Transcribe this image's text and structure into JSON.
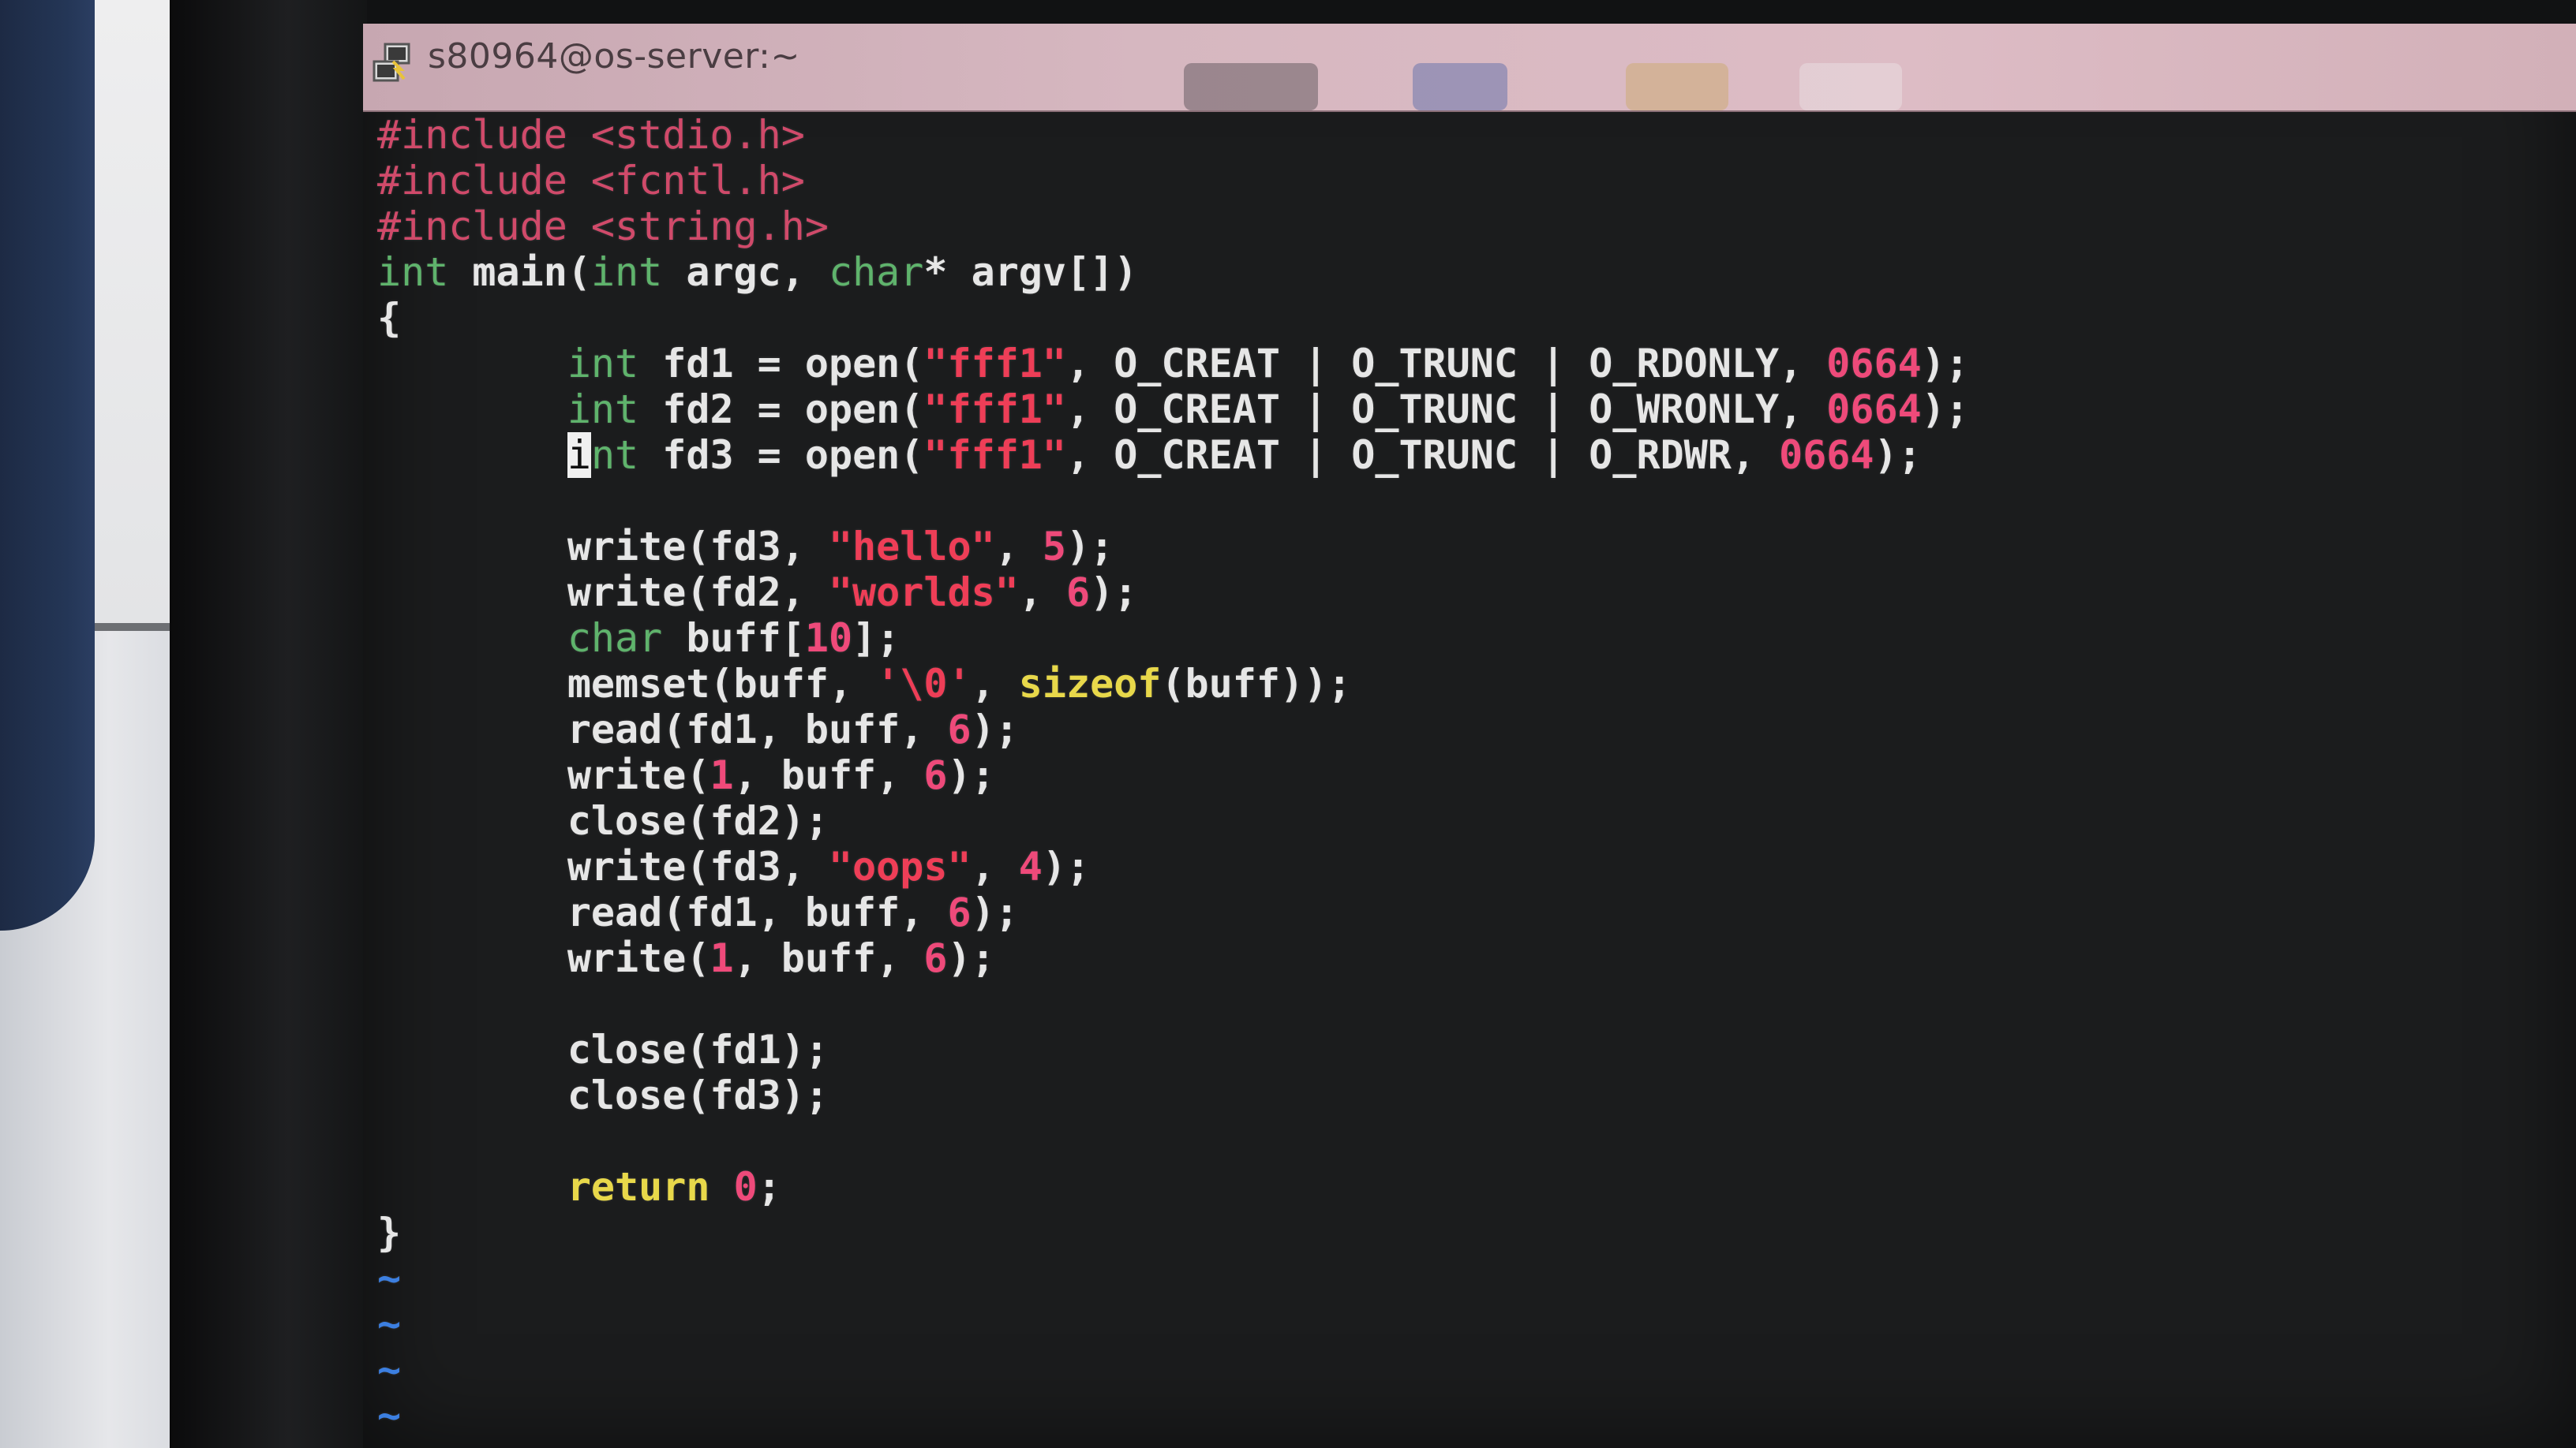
{
  "window": {
    "title": "s80964@os-server:~",
    "icon": "putty-terminal-icon"
  },
  "colors": {
    "preprocessor": "#d04a6a",
    "type_keyword": "#5fb36c",
    "string": "#ee3e57",
    "number": "#ee4a7a",
    "statement": "#e8d84a",
    "text": "#e6e6e6",
    "tilde": "#3c7fe0",
    "titlebar": "#d6b7c0"
  },
  "editor": {
    "cursor_line": 7,
    "lines": [
      [
        [
          "pp",
          "#include <stdio.h>"
        ]
      ],
      [
        [
          "pp",
          "#include <fcntl.h>"
        ]
      ],
      [
        [
          "pp",
          "#include <string.h>"
        ]
      ],
      [
        [
          "kw",
          "int"
        ],
        [
          "id",
          " main("
        ],
        [
          "kw",
          "int"
        ],
        [
          "id",
          " argc, "
        ],
        [
          "kw",
          "char"
        ],
        [
          "id",
          "* argv[])"
        ]
      ],
      [
        [
          "id",
          "{"
        ]
      ],
      [
        [
          "id",
          "        "
        ],
        [
          "kw",
          "int"
        ],
        [
          "id",
          " fd1 = open("
        ],
        [
          "str",
          "\"fff1\""
        ],
        [
          "id",
          ", O_CREAT | O_TRUNC | O_RDONLY, "
        ],
        [
          "num",
          "0664"
        ],
        [
          "id",
          ");"
        ]
      ],
      [
        [
          "id",
          "        "
        ],
        [
          "kw",
          "int"
        ],
        [
          "id",
          " fd2 = open("
        ],
        [
          "str",
          "\"fff1\""
        ],
        [
          "id",
          ", O_CREAT | O_TRUNC | O_WRONLY, "
        ],
        [
          "num",
          "0664"
        ],
        [
          "id",
          ");"
        ]
      ],
      [
        [
          "id",
          "        "
        ],
        [
          "cursor",
          "i"
        ],
        [
          "kw",
          "nt"
        ],
        [
          "id",
          " fd3 = open("
        ],
        [
          "str",
          "\"fff1\""
        ],
        [
          "id",
          ", O_CREAT | O_TRUNC | O_RDWR, "
        ],
        [
          "num",
          "0664"
        ],
        [
          "id",
          ");"
        ]
      ],
      [
        [
          "id",
          ""
        ]
      ],
      [
        [
          "id",
          "        write(fd3, "
        ],
        [
          "str",
          "\"hello\""
        ],
        [
          "id",
          ", "
        ],
        [
          "num",
          "5"
        ],
        [
          "id",
          ");"
        ]
      ],
      [
        [
          "id",
          "        write(fd2, "
        ],
        [
          "str",
          "\"worlds\""
        ],
        [
          "id",
          ", "
        ],
        [
          "num",
          "6"
        ],
        [
          "id",
          ");"
        ]
      ],
      [
        [
          "id",
          "        "
        ],
        [
          "kw",
          "char"
        ],
        [
          "id",
          " buff["
        ],
        [
          "num",
          "10"
        ],
        [
          "id",
          "];"
        ]
      ],
      [
        [
          "id",
          "        memset(buff, "
        ],
        [
          "str",
          "'\\0'"
        ],
        [
          "id",
          ", "
        ],
        [
          "yel",
          "sizeof"
        ],
        [
          "id",
          "(buff));"
        ]
      ],
      [
        [
          "id",
          "        read(fd1, buff, "
        ],
        [
          "num",
          "6"
        ],
        [
          "id",
          ");"
        ]
      ],
      [
        [
          "id",
          "        write("
        ],
        [
          "num",
          "1"
        ],
        [
          "id",
          ", buff, "
        ],
        [
          "num",
          "6"
        ],
        [
          "id",
          ");"
        ]
      ],
      [
        [
          "id",
          "        close(fd2);"
        ]
      ],
      [
        [
          "id",
          "        write(fd3, "
        ],
        [
          "str",
          "\"oops\""
        ],
        [
          "id",
          ", "
        ],
        [
          "num",
          "4"
        ],
        [
          "id",
          ");"
        ]
      ],
      [
        [
          "id",
          "        read(fd1, buff, "
        ],
        [
          "num",
          "6"
        ],
        [
          "id",
          ");"
        ]
      ],
      [
        [
          "id",
          "        write("
        ],
        [
          "num",
          "1"
        ],
        [
          "id",
          ", buff, "
        ],
        [
          "num",
          "6"
        ],
        [
          "id",
          ");"
        ]
      ],
      [
        [
          "id",
          ""
        ]
      ],
      [
        [
          "id",
          "        close(fd1);"
        ]
      ],
      [
        [
          "id",
          "        close(fd3);"
        ]
      ],
      [
        [
          "id",
          ""
        ]
      ],
      [
        [
          "id",
          "        "
        ],
        [
          "yel",
          "return"
        ],
        [
          "id",
          " "
        ],
        [
          "num",
          "0"
        ],
        [
          "id",
          ";"
        ]
      ],
      [
        [
          "id",
          "}"
        ]
      ],
      [
        [
          "tilde",
          "~"
        ]
      ],
      [
        [
          "tilde",
          "~"
        ]
      ],
      [
        [
          "tilde",
          "~"
        ]
      ],
      [
        [
          "tilde",
          "~"
        ]
      ]
    ]
  }
}
